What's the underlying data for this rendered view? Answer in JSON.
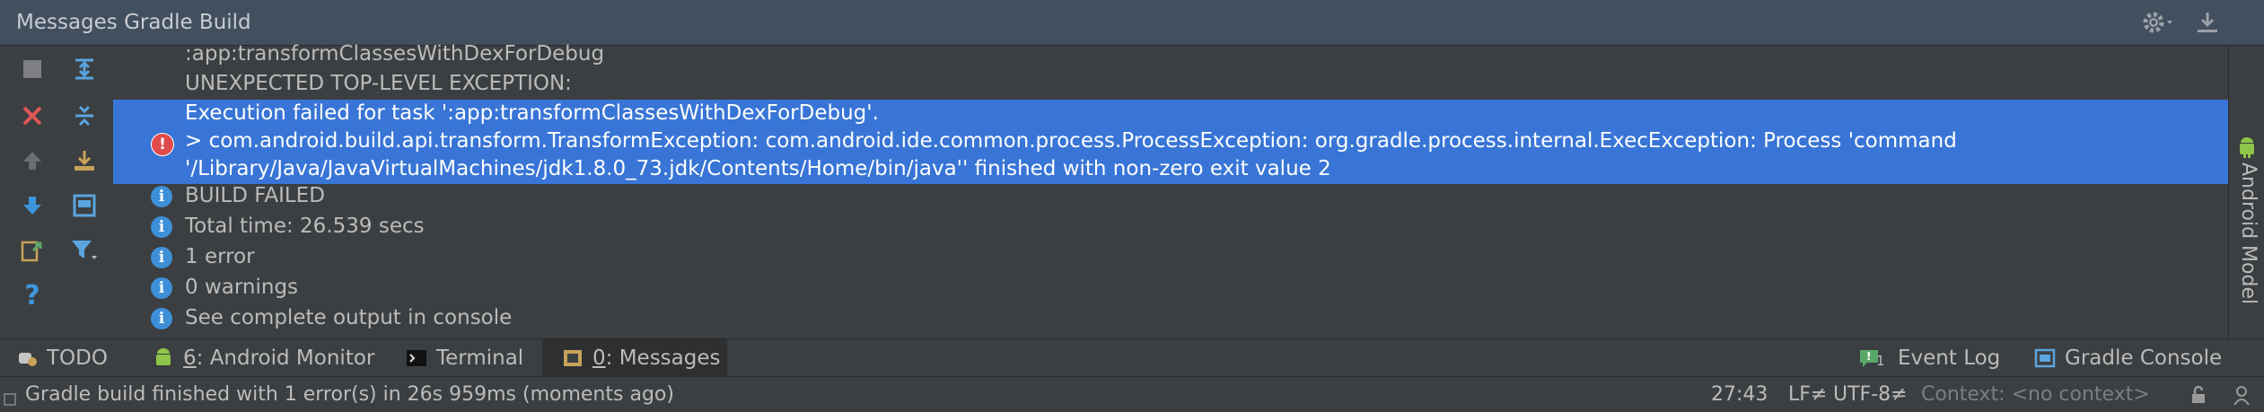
{
  "window": {
    "title": "Messages Gradle Build"
  },
  "messages": {
    "lines_before": [
      ":app:transformClassesWithDexForDebug",
      "UNEXPECTED TOP-LEVEL EXCEPTION:"
    ],
    "error": {
      "line1": "Execution failed for task ':app:transformClassesWithDexForDebug'.",
      "line2": "> com.android.build.api.transform.TransformException: com.android.ide.common.process.ProcessException: org.gradle.process.internal.ExecException: Process 'command",
      "line3": "'/Library/Java/JavaVirtualMachines/jdk1.8.0_73.jdk/Contents/Home/bin/java'' finished with non-zero exit value 2"
    },
    "info": [
      "BUILD FAILED",
      "Total time: 26.539 secs",
      "1 error",
      "0 warnings",
      "See complete output in console"
    ]
  },
  "right_strip": {
    "label": "Android Model"
  },
  "tool_tabs": {
    "todo": "TODO",
    "android_monitor_num": "6",
    "android_monitor": ": Android Monitor",
    "terminal": "Terminal",
    "messages_num": "0",
    "messages": ": Messages",
    "event_log_count": "1",
    "event_log": "Event Log",
    "gradle_console": "Gradle Console"
  },
  "status": {
    "message": "Gradle build finished with 1 error(s) in 26s 959ms (moments ago)",
    "position": "27:43",
    "line_sep": "LF≠",
    "encoding": "UTF-8≠",
    "context": "Context: <no context>"
  },
  "colors": {
    "selection": "#3875d6",
    "info_icon": "#3d8fd8",
    "error_icon": "#e14a4a"
  }
}
